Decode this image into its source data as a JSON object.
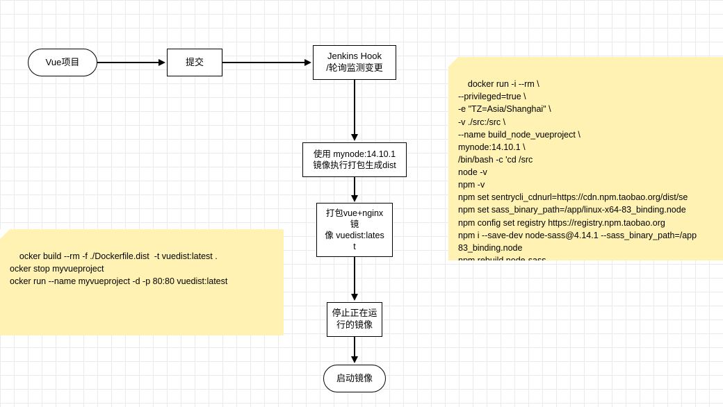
{
  "nodes": {
    "vue_project": "Vue项目",
    "submit": "提交",
    "jenkins_hook": "Jenkins Hook\n/轮询监测变更",
    "use_mynode": "使用 mynode:14.10.1\n镜像执行打包生成dist",
    "pack_vue_nginx": "打包vue+nginx\n镜\n像 vuedist:lates\nt",
    "stop_running": "停止正在运\n行的镜像",
    "start_image": "启动镜像"
  },
  "notes": {
    "left": "ocker build --rm -f ./Dockerfile.dist  -t vuedist:latest .\nocker stop myvueproject\nocker run --name myvueproject -d -p 80:80 vuedist:latest",
    "right": "docker run -i --rm \\\n--privileged=true \\\n-e \"TZ=Asia/Shanghai\" \\\n-v ./src:/src \\\n--name build_node_vueproject \\\nmynode:14.10.1 \\\n/bin/bash -c 'cd /src\nnode -v\nnpm -v\nnpm set sentrycli_cdnurl=https://cdn.npm.taobao.org/dist/se\nnpm set sass_binary_path=/app/linux-x64-83_binding.node\nnpm config set registry https://registry.npm.taobao.org\nnpm i --save-dev node-sass@4.14.1 --sass_binary_path=/app\n83_binding.node\nnpm rebuild node-sass\nnpm install\nnpm run prod'"
  }
}
